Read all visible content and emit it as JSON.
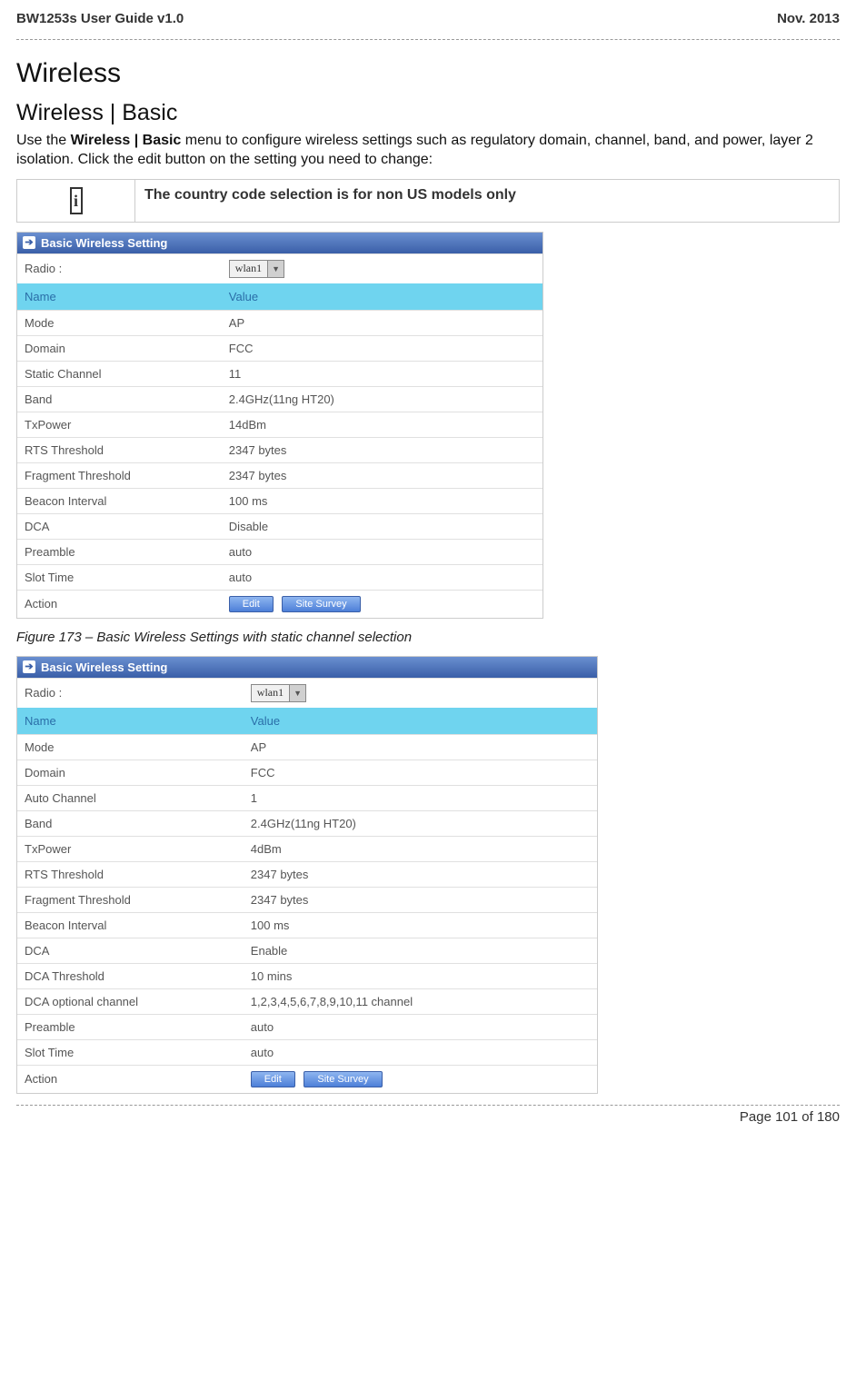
{
  "header": {
    "left": "BW1253s User Guide v1.0",
    "right": "Nov.  2013"
  },
  "headings": {
    "main": "Wireless",
    "sub": "Wireless | Basic"
  },
  "intro_prefix": "Use the ",
  "intro_bold": "Wireless | Basic",
  "intro_suffix": " menu to configure wireless settings such as regulatory domain, channel, band, and power, layer 2 isolation. Click the edit button on the setting you need to change:",
  "note": {
    "icon": "i",
    "text": "The country code selection is for non US models only"
  },
  "panel1": {
    "title": "Basic Wireless Setting",
    "radio_label": "Radio :",
    "radio_value": "wlan1",
    "col_name": "Name",
    "col_value": "Value",
    "rows": [
      {
        "name": "Mode",
        "value": "AP"
      },
      {
        "name": "Domain",
        "value": "FCC"
      },
      {
        "name": "Static Channel",
        "value": "11"
      },
      {
        "name": "Band",
        "value": "2.4GHz(11ng HT20)"
      },
      {
        "name": "TxPower",
        "value": "14dBm"
      },
      {
        "name": "RTS Threshold",
        "value": "2347 bytes"
      },
      {
        "name": "Fragment Threshold",
        "value": "2347 bytes"
      },
      {
        "name": "Beacon Interval",
        "value": "100 ms"
      },
      {
        "name": "DCA",
        "value": "Disable"
      },
      {
        "name": "Preamble",
        "value": "auto"
      },
      {
        "name": "Slot Time",
        "value": "auto"
      }
    ],
    "action_label": "Action",
    "edit_btn": "Edit",
    "survey_btn": "Site Survey"
  },
  "figure_caption": "Figure 173 – Basic Wireless Settings with static channel selection",
  "panel2": {
    "title": "Basic Wireless Setting",
    "radio_label": "Radio :",
    "radio_value": "wlan1",
    "col_name": "Name",
    "col_value": "Value",
    "rows": [
      {
        "name": "Mode",
        "value": "AP"
      },
      {
        "name": "Domain",
        "value": "FCC"
      },
      {
        "name": "Auto Channel",
        "value": "1"
      },
      {
        "name": "Band",
        "value": "2.4GHz(11ng HT20)"
      },
      {
        "name": "TxPower",
        "value": "4dBm"
      },
      {
        "name": "RTS Threshold",
        "value": "2347 bytes"
      },
      {
        "name": "Fragment Threshold",
        "value": "2347 bytes"
      },
      {
        "name": "Beacon Interval",
        "value": "100 ms"
      },
      {
        "name": "DCA",
        "value": "Enable"
      },
      {
        "name": "DCA Threshold",
        "value": "10 mins"
      },
      {
        "name": "DCA optional channel",
        "value": "1,2,3,4,5,6,7,8,9,10,11 channel"
      },
      {
        "name": "Preamble",
        "value": "auto"
      },
      {
        "name": "Slot Time",
        "value": "auto"
      }
    ],
    "action_label": "Action",
    "edit_btn": "Edit",
    "survey_btn": "Site Survey"
  },
  "footer": "Page 101 of 180"
}
